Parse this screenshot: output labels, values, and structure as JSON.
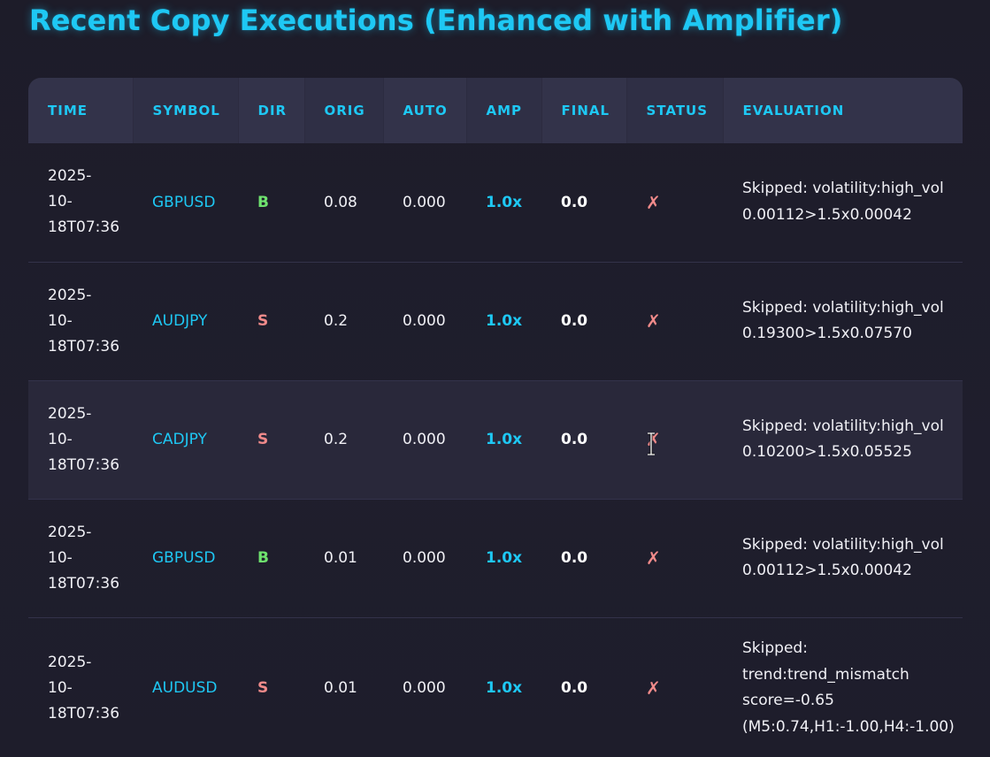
{
  "page": {
    "title": "Recent Copy Executions (Enhanced with Amplifier)"
  },
  "table": {
    "headers": [
      "TIME",
      "SYMBOL",
      "DIR",
      "ORIG",
      "AUTO",
      "AMP",
      "FINAL",
      "STATUS",
      "EVALUATION"
    ],
    "rows": [
      {
        "time": [
          "2025-",
          "10-",
          "18T07:36"
        ],
        "symbol": "GBPUSD",
        "dir": "B",
        "orig": "0.08",
        "auto": "0.000",
        "amp": "1.0x",
        "final": "0.0",
        "status": "✗",
        "evaluation": [
          "Skipped: volatility:high_vol",
          "0.00112>1.5x0.00042"
        ]
      },
      {
        "time": [
          "2025-",
          "10-",
          "18T07:36"
        ],
        "symbol": "AUDJPY",
        "dir": "S",
        "orig": "0.2",
        "auto": "0.000",
        "amp": "1.0x",
        "final": "0.0",
        "status": "✗",
        "evaluation": [
          "Skipped: volatility:high_vol",
          "0.19300>1.5x0.07570"
        ]
      },
      {
        "time": [
          "2025-",
          "10-",
          "18T07:36"
        ],
        "symbol": "CADJPY",
        "dir": "S",
        "orig": "0.2",
        "auto": "0.000",
        "amp": "1.0x",
        "final": "0.0",
        "status": "✗",
        "evaluation": [
          "Skipped: volatility:high_vol",
          "0.10200>1.5x0.05525"
        ]
      },
      {
        "time": [
          "2025-",
          "10-",
          "18T07:36"
        ],
        "symbol": "GBPUSD",
        "dir": "B",
        "orig": "0.01",
        "auto": "0.000",
        "amp": "1.0x",
        "final": "0.0",
        "status": "✗",
        "evaluation": [
          "Skipped: volatility:high_vol",
          "0.00112>1.5x0.00042"
        ]
      },
      {
        "time": [
          "2025-",
          "10-",
          "18T07:36"
        ],
        "symbol": "AUDUSD",
        "dir": "S",
        "orig": "0.01",
        "auto": "0.000",
        "amp": "1.0x",
        "final": "0.0",
        "status": "✗",
        "evaluation": [
          "Skipped:",
          "trend:trend_mismatch",
          "score=-0.65",
          "(M5:0.74,H1:-1.00,H4:-1.00)"
        ]
      }
    ]
  },
  "colors": {
    "accent": "#1ec8f4",
    "buy": "#6ee26e",
    "sell": "#f08a8a",
    "status_fail": "#f08a8a"
  }
}
